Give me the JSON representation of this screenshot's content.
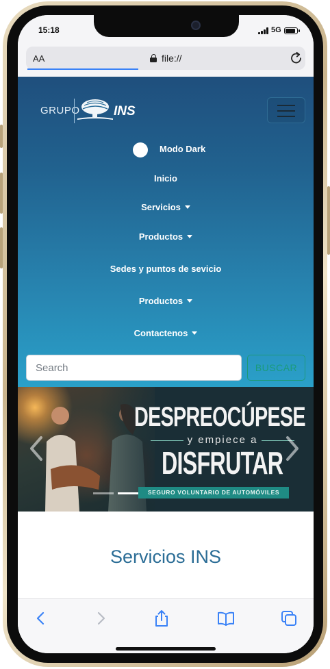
{
  "status_bar": {
    "time": "15:18",
    "network": "5G",
    "battery_level": 0.9
  },
  "browser": {
    "text_size_label": "AA",
    "url": "file://",
    "icons": [
      "lock-icon",
      "reload-icon",
      "back-icon",
      "forward-icon",
      "share-icon",
      "bookmarks-icon",
      "tabs-icon"
    ],
    "accent_color": "#3a82f7"
  },
  "header": {
    "logo": {
      "grupo": "GRUPO",
      "brand": "INS"
    },
    "dark_mode_label": "Modo Dark",
    "nav": [
      {
        "label": "Inicio",
        "dropdown": false
      },
      {
        "label": "Servicios",
        "dropdown": true
      },
      {
        "label": "Productos",
        "dropdown": true
      },
      {
        "label": "Sedes y puntos de sevicio",
        "dropdown": false
      },
      {
        "label": "Productos",
        "dropdown": true
      },
      {
        "label": "Contactenos",
        "dropdown": true
      }
    ],
    "search": {
      "placeholder": "Search",
      "button_label": "BUSCAR"
    },
    "gradient_colors": [
      "#1f4f7d",
      "#2aa0c9"
    ],
    "search_button_color": "#1b9b7b"
  },
  "carousel": {
    "headline": "DESPREOCÚPESE",
    "subheadline": "y empiece a",
    "headline2": "DISFRUTAR",
    "tag": "SEGURO VOLUNTARIO DE AUTOMÓVILES",
    "slide_count": 2,
    "active_slide": 2
  },
  "content": {
    "section_title": "Servicios INS",
    "title_color": "#2b6d96"
  }
}
